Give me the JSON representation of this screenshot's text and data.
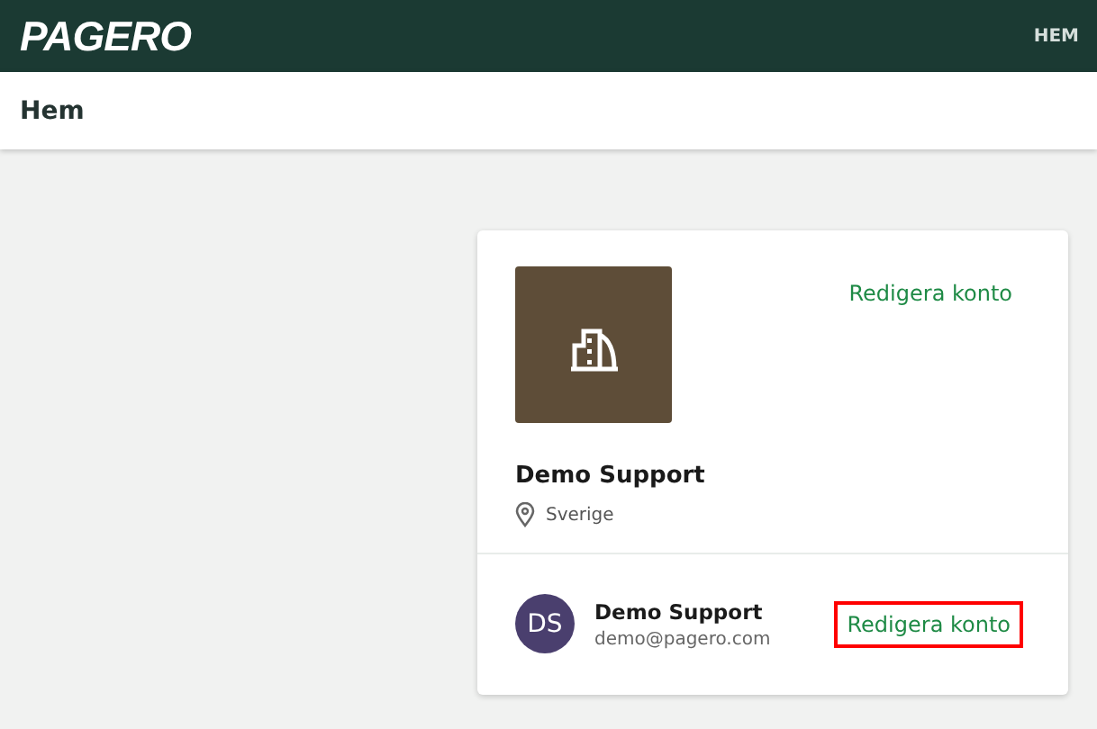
{
  "header": {
    "logo": "PAGERO",
    "nav": "HEM"
  },
  "page_title": "Hem",
  "company": {
    "edit_link": "Redigera konto",
    "name": "Demo Support",
    "location": "Sverige"
  },
  "user": {
    "initials": "DS",
    "name": "Demo Support",
    "email": "demo@pagero.com",
    "edit_link": "Redigera konto",
    "highlighted": true
  }
}
